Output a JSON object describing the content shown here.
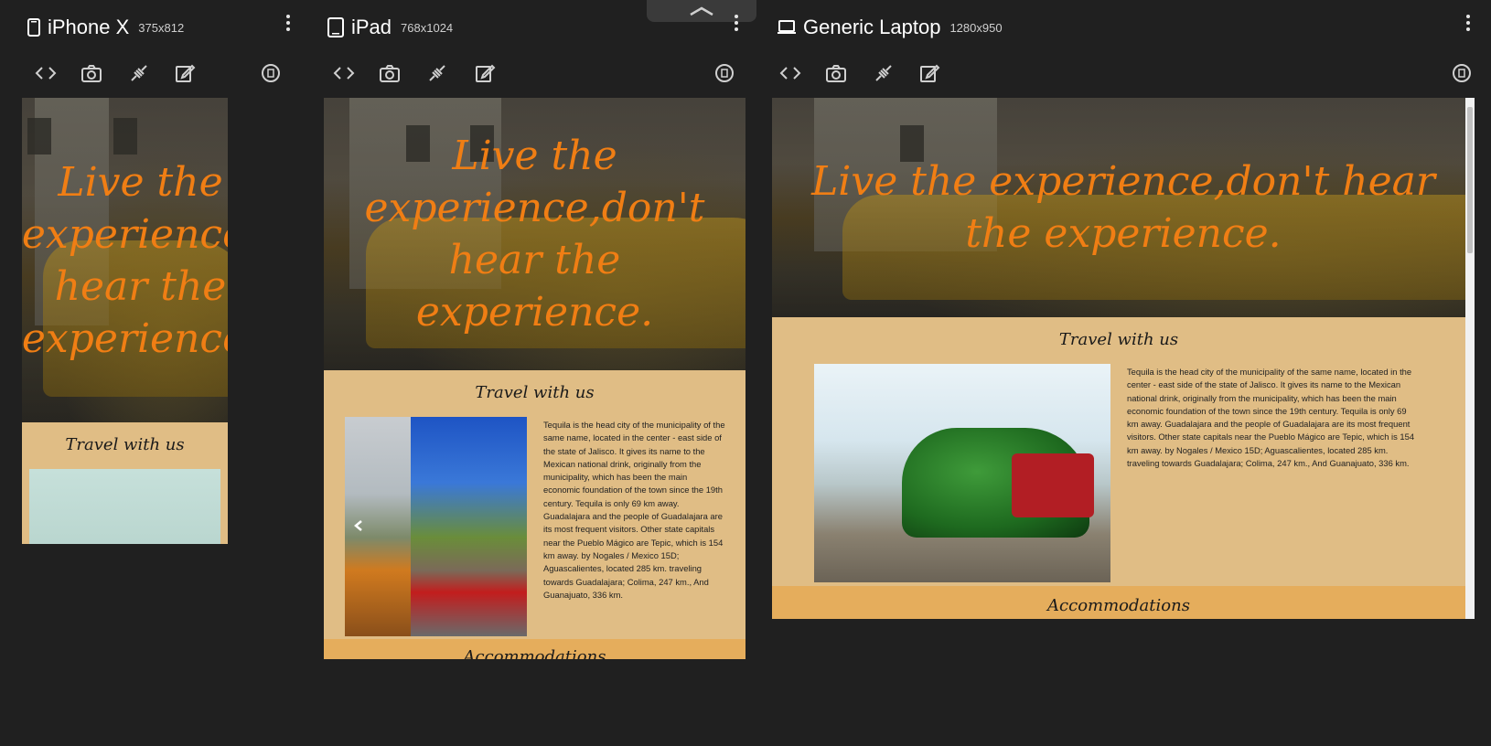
{
  "devices": [
    {
      "name": "iPhone X",
      "size": "375x812",
      "icon": "phone-icon"
    },
    {
      "name": "iPad",
      "size": "768x1024",
      "icon": "tablet-icon"
    },
    {
      "name": "Generic Laptop",
      "size": "1280x950",
      "icon": "laptop-icon"
    }
  ],
  "toolbar_icons": [
    "code-icon",
    "screenshot-icon",
    "disconnect-icon",
    "edit-icon",
    "rotate-icon"
  ],
  "site": {
    "hero_text": "Live the experience,don't hear the experience.",
    "hero_text_phone": "Live the experience, hear the experience.",
    "travel_title": "Travel with us",
    "travel_text": "Tequila is the head city of the municipality of the same name, located in the center - east side of the state of Jalisco. It gives its name to the Mexican national drink, originally from the municipality, which has been the main economic foundation of the town since the 19th century. Tequila is only 69 km away. Guadalajara and the people of Guadalajara are its most frequent visitors. Other state capitals near the Pueblo Mágico are Tepic, which is 154 km away. by Nogales / Mexico 15D; Aguascalientes, located 285 km. traveling towards Guadalajara; Colima, 247 km., And Guanajuato, 336 km.",
    "accommodations_title": "Accommodations"
  },
  "colors": {
    "background": "#202020",
    "hero_text": "#f07e14",
    "section_bg": "#e0bd85",
    "accommodations_bg": "#e5ad5c"
  }
}
